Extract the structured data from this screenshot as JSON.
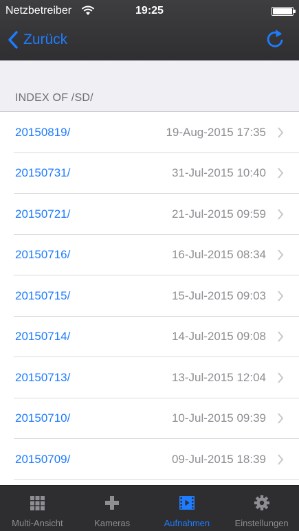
{
  "status": {
    "carrier": "Netzbetreiber",
    "time": "19:25"
  },
  "nav": {
    "back_label": "Zurück"
  },
  "section": {
    "title": "INDEX OF /SD/"
  },
  "entries": [
    {
      "name": "20150819/",
      "date": "19-Aug-2015 17:35"
    },
    {
      "name": "20150731/",
      "date": "31-Jul-2015 10:40"
    },
    {
      "name": "20150721/",
      "date": "21-Jul-2015 09:59"
    },
    {
      "name": "20150716/",
      "date": "16-Jul-2015 08:34"
    },
    {
      "name": "20150715/",
      "date": "15-Jul-2015 09:03"
    },
    {
      "name": "20150714/",
      "date": "14-Jul-2015 09:08"
    },
    {
      "name": "20150713/",
      "date": "13-Jul-2015 12:04"
    },
    {
      "name": "20150710/",
      "date": "10-Jul-2015 09:39"
    },
    {
      "name": "20150709/",
      "date": "09-Jul-2015 18:39"
    }
  ],
  "tabs": [
    {
      "label": "Multi-Ansicht",
      "icon": "grid-icon"
    },
    {
      "label": "Kameras",
      "icon": "plus-icon"
    },
    {
      "label": "Aufnahmen",
      "icon": "film-icon",
      "active": true
    },
    {
      "label": "Einstellungen",
      "icon": "gear-icon"
    }
  ],
  "colors": {
    "accent": "#1e7dff",
    "bar": "#2e2e30",
    "secondary_text": "#8e8e93"
  }
}
